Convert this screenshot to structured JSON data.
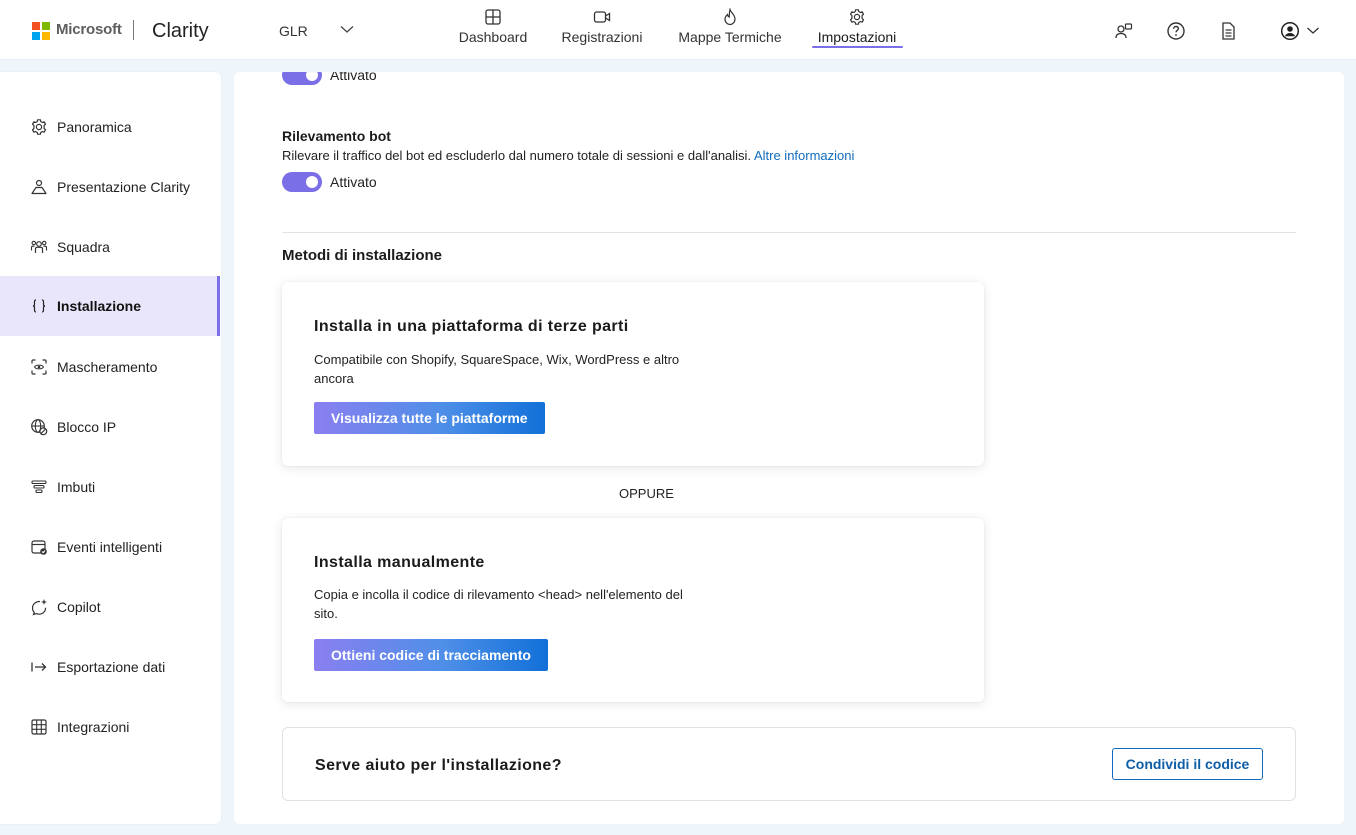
{
  "header": {
    "ms_brand": "Microsoft",
    "app_name": "Clarity",
    "project": "GLR",
    "tabs": [
      {
        "label": "Dashboard",
        "icon": "dashboard-grid-icon"
      },
      {
        "label": "Registrazioni",
        "icon": "video-camera-icon"
      },
      {
        "label": "Mappe Termiche",
        "icon": "flame-icon"
      },
      {
        "label": "Impostazioni",
        "icon": "gear-icon",
        "active": true
      }
    ],
    "right_icons": [
      "people-settings-icon",
      "help-question-icon",
      "document-icon",
      "account-avatar-icon",
      "chevron-down-icon"
    ]
  },
  "sidebar": {
    "items": [
      {
        "label": "Panoramica",
        "icon": "gear-icon"
      },
      {
        "label": "Presentazione Clarity",
        "icon": "presenter-icon"
      },
      {
        "label": "Squadra",
        "icon": "people-team-icon"
      },
      {
        "label": "Installazione",
        "icon": "braces-icon",
        "active": true
      },
      {
        "label": "Mascheramento",
        "icon": "scan-mask-icon"
      },
      {
        "label": "Blocco IP",
        "icon": "globe-block-icon"
      },
      {
        "label": "Imbuti",
        "icon": "funnel-icon"
      },
      {
        "label": "Eventi intelligenti",
        "icon": "calendar-event-icon"
      },
      {
        "label": "Copilot",
        "icon": "copilot-sparkle-icon"
      },
      {
        "label": "Esportazione dati",
        "icon": "arrow-export-icon"
      },
      {
        "label": "Integrazioni",
        "icon": "integrations-grid-icon"
      }
    ]
  },
  "main": {
    "top_toggle": {
      "label": "Attivato",
      "on": true
    },
    "bot_detection": {
      "title": "Rilevamento bot",
      "description": "Rilevare il traffico del bot ed escluderlo dal numero totale di sessioni e dall'analisi.",
      "link": "Altre informazioni",
      "toggle_label": "Attivato",
      "on": true
    },
    "install_methods_title": "Metodi di installazione",
    "third_party": {
      "title": "Installa in una piattaforma di terze parti",
      "description": "Compatibile con Shopify, SquareSpace, Wix, WordPress e altro ancora",
      "button": "Visualizza tutte le piattaforme"
    },
    "or_label": "OPPURE",
    "manual": {
      "title": "Installa manualmente",
      "description": "Copia e incolla il codice di rilevamento <head> nell'elemento del sito.",
      "button": "Ottieni codice di tracciamento"
    },
    "help": {
      "text": "Serve aiuto per l'installazione?",
      "button": "Condividi il codice"
    }
  },
  "colors": {
    "accent": "#7b6fe8",
    "link": "#0f6cbd",
    "background": "#eef5fb",
    "active_item_bg": "#e9e6fb"
  }
}
